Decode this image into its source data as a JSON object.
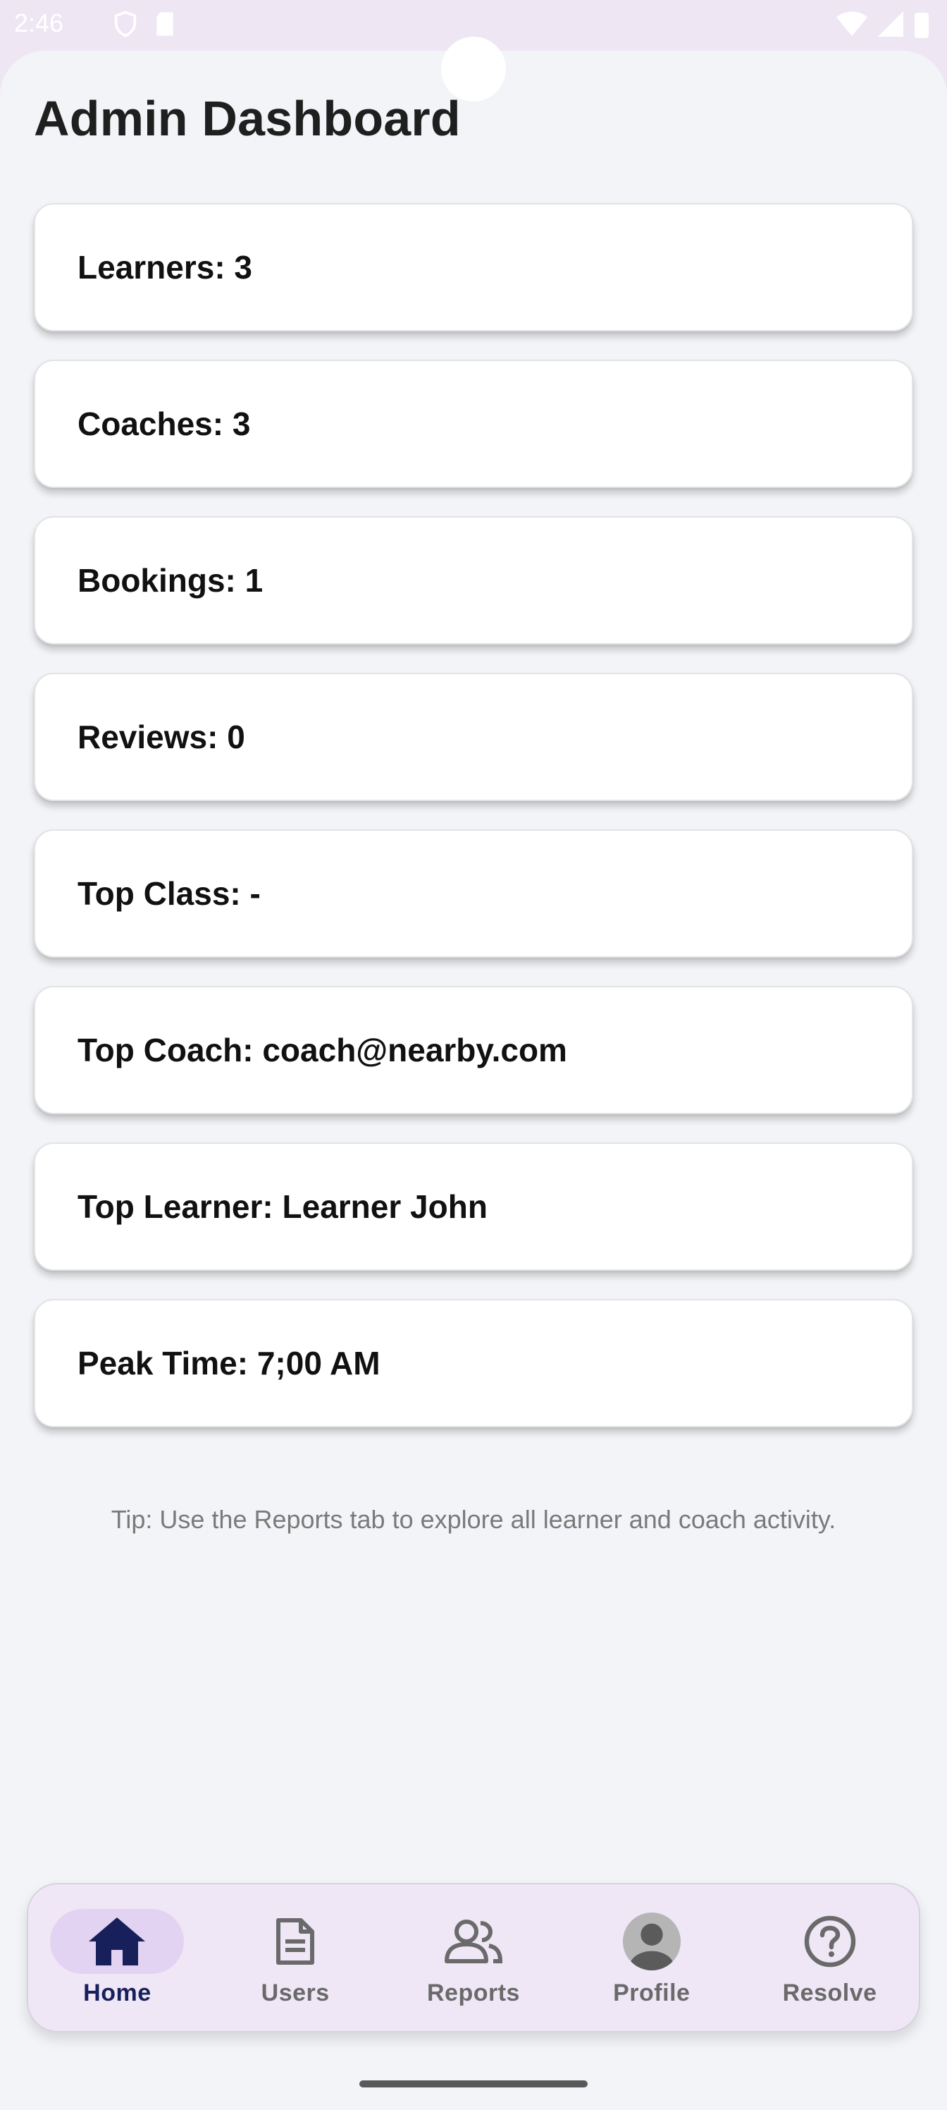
{
  "status_bar": {
    "time": "2:46"
  },
  "header": {
    "title": "Admin Dashboard"
  },
  "stats": [
    {
      "text": "Learners: 3"
    },
    {
      "text": "Coaches: 3"
    },
    {
      "text": "Bookings: 1"
    },
    {
      "text": "Reviews: 0"
    },
    {
      "text": "Top Class: -"
    },
    {
      "text": "Top Coach: coach@nearby.com"
    },
    {
      "text": "Top Learner: Learner John"
    },
    {
      "text": "Peak Time: 7;00 AM"
    }
  ],
  "tip": "Tip: Use the Reports tab to explore all learner and coach activity.",
  "nav": {
    "items": [
      {
        "label": "Home",
        "icon": "home-icon",
        "active": true
      },
      {
        "label": "Users",
        "icon": "document-icon",
        "active": false
      },
      {
        "label": "Reports",
        "icon": "people-icon",
        "active": false
      },
      {
        "label": "Profile",
        "icon": "avatar-icon",
        "active": false
      },
      {
        "label": "Resolve",
        "icon": "help-circle-icon",
        "active": false
      }
    ]
  },
  "colors": {
    "accent": "#17205a",
    "nav_background": "#efe6f6",
    "active_pill": "#e3d3f2",
    "page_background": "#f3f4f7"
  }
}
